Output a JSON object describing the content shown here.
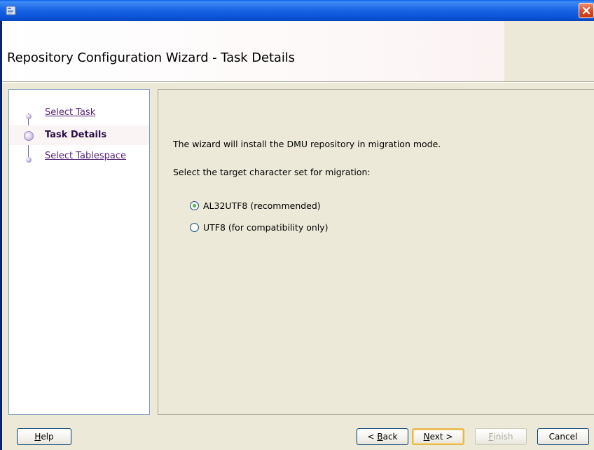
{
  "window": {
    "title": "",
    "header_title": "Repository Configuration Wizard - Task Details"
  },
  "nav": {
    "items": [
      {
        "label": "Select Task",
        "state": "visited"
      },
      {
        "label": "Task Details",
        "state": "active"
      },
      {
        "label": "Select Tablespace",
        "state": "pending"
      }
    ]
  },
  "content": {
    "intro": "The wizard will install the DMU repository in migration mode.",
    "prompt": "Select the target character set for migration:",
    "options": [
      {
        "label": "AL32UTF8 (recommended)",
        "checked": true
      },
      {
        "label": "UTF8 (for compatibility only)",
        "checked": false
      }
    ]
  },
  "footer": {
    "help": {
      "mnemonic": "H",
      "rest": "elp"
    },
    "back": {
      "prefix": "< ",
      "mnemonic": "B",
      "rest": "ack"
    },
    "next": {
      "mnemonic": "N",
      "rest": "ext >"
    },
    "finish": {
      "mnemonic": "F",
      "rest": "inish"
    },
    "cancel": "Cancel"
  },
  "colors": {
    "titlebar": "#0a5fe8",
    "nav_link": "#55257a",
    "default_button_border": "#e6b84a",
    "radio_dot": "#21a121"
  }
}
